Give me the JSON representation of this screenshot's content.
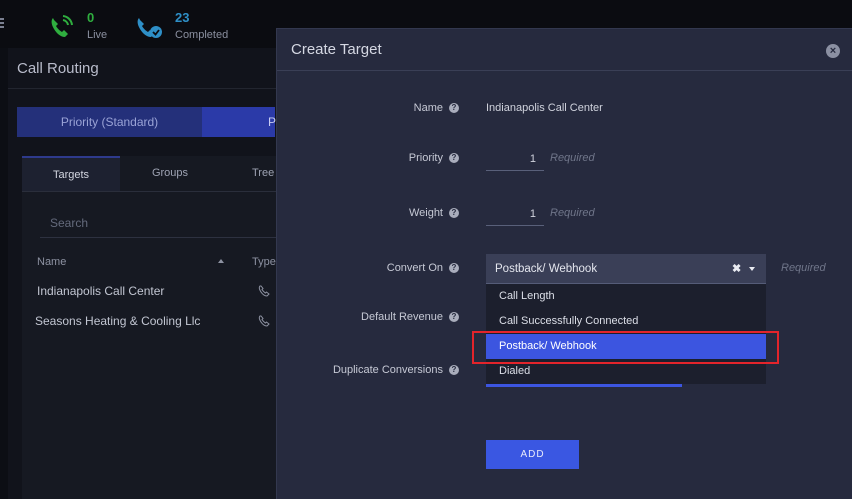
{
  "header": {
    "live": {
      "count": "0",
      "label": "Live"
    },
    "completed": {
      "count": "23",
      "label": "Completed"
    }
  },
  "page": {
    "title": "Call Routing",
    "strategy": {
      "option_a": "Priority (Standard)",
      "option_b": "P"
    },
    "tabs": [
      "Targets",
      "Groups",
      "Tree"
    ],
    "search": {
      "placeholder": "Search"
    },
    "table": {
      "columns": [
        "Name",
        "Type"
      ],
      "rows": [
        {
          "name": "Indianapolis Call Center",
          "type_icon": "phone-icon"
        },
        {
          "name": "Seasons Heating & Cooling Llc",
          "type_icon": "phone-icon"
        }
      ]
    }
  },
  "modal": {
    "title": "Create Target",
    "fields": {
      "name": {
        "label": "Name",
        "value": "Indianapolis Call Center"
      },
      "priority": {
        "label": "Priority",
        "value": "1",
        "hint": "Required"
      },
      "weight": {
        "label": "Weight",
        "value": "1",
        "hint": "Required"
      },
      "convert_on": {
        "label": "Convert On",
        "value": "Postback/ Webhook",
        "hint": "Required"
      },
      "default_revenue": {
        "label": "Default Revenue"
      },
      "duplicate_conversions": {
        "label": "Duplicate Conversions"
      }
    },
    "dropdown_options": [
      "Call Length",
      "Call Successfully Connected",
      "Postback/ Webhook",
      "Dialed"
    ],
    "selected_option_index": 2,
    "add_button": "ADD"
  },
  "colors": {
    "accent": "#3c55e0",
    "live_green": "#2fae3f",
    "completed_blue": "#2e8fc7",
    "highlight_red": "#e3242b"
  }
}
